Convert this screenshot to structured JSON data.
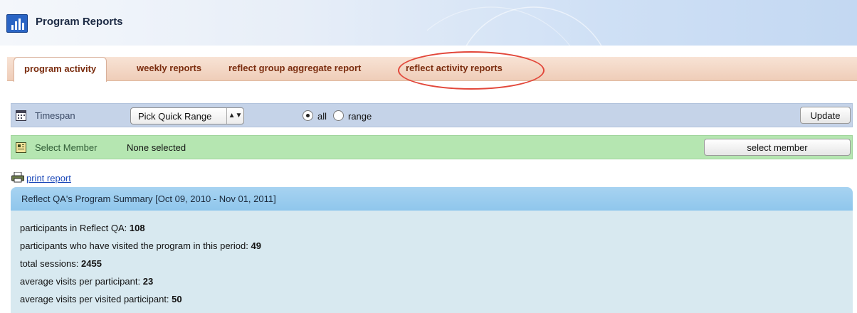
{
  "header": {
    "title": "Program Reports",
    "icon": "bar-chart-icon"
  },
  "tabs": [
    {
      "label": "program activity",
      "active": true
    },
    {
      "label": "weekly reports",
      "active": false
    },
    {
      "label": "reflect group aggregate report",
      "active": false
    },
    {
      "label": "reflect activity reports",
      "active": false
    }
  ],
  "timespan": {
    "label": "Timespan",
    "icon": "calendar-icon",
    "quick_range": "Pick Quick Range",
    "radio_all": "all",
    "radio_range": "range",
    "selected": "all",
    "update_label": "Update"
  },
  "member": {
    "label": "Select Member",
    "icon": "member-card-icon",
    "value": "None selected",
    "button_label": "select member"
  },
  "print": {
    "label": "print report",
    "icon": "printer-icon"
  },
  "summary": {
    "title": "Reflect QA's Program Summary [Oct 09, 2010 - Nov 01, 2011]",
    "stats": [
      {
        "label": "participants in Reflect QA:",
        "value": "108"
      },
      {
        "label": "participants who have visited the program in this period:",
        "value": "49"
      },
      {
        "label": "total sessions:",
        "value": "2455"
      },
      {
        "label": "average visits per participant:",
        "value": "23"
      },
      {
        "label": "average visits per visited participant:",
        "value": "50"
      }
    ]
  },
  "colors": {
    "tab_text": "#7a2c0e",
    "timespan_bg": "#c5d3e8",
    "member_bg": "#b5e6b1",
    "summary_head": "#a7d3f1",
    "summary_bg": "#d8e9f0",
    "highlight": "#e2473a"
  }
}
